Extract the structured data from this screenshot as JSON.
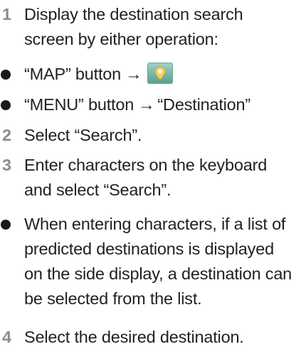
{
  "steps": [
    {
      "number": "1",
      "lines": [
        "Display the destination search",
        "screen by either operation:"
      ]
    },
    {
      "number": "2",
      "lines": [
        "Select “Search”."
      ]
    },
    {
      "number": "3",
      "lines": [
        "Enter characters on the keyboard",
        "and select “Search”."
      ]
    },
    {
      "number": "4",
      "lines": [
        "Select the desired destination."
      ]
    }
  ],
  "bullets": [
    {
      "text": "“MAP” button",
      "arrow": "→",
      "icon": "destination-pin-icon"
    },
    {
      "text": "“MENU” button",
      "arrow": "→",
      "target": "“Destination”"
    },
    {
      "lines": [
        "When entering characters, if a list of",
        "predicted destinations is displayed",
        "on the side display, a destination can",
        "be selected from the list."
      ]
    }
  ],
  "colors": {
    "step_number": "#8c8c8c",
    "text": "#231f20",
    "icon_bg": "#7fb9ab"
  }
}
